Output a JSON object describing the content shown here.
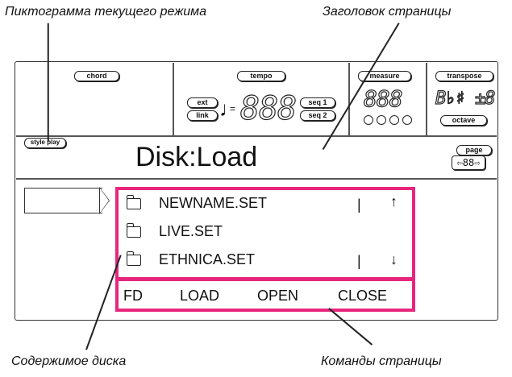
{
  "captions": {
    "top_left": "Пиктограмма текущего режима",
    "top_right": "Заголовок страницы",
    "bottom_left": "Содержимое диска",
    "bottom_right": "Команды страницы"
  },
  "labels": {
    "chord": "chord",
    "tempo": "tempo",
    "ext": "ext",
    "link": "link",
    "seq1": "seq 1",
    "seq2": "seq 2",
    "measure": "measure",
    "transpose": "transpose",
    "octave": "octave",
    "style_play": "style play",
    "page": "page"
  },
  "readouts": {
    "tempo_digits": "888",
    "measure_digits": "888",
    "transpose_digits": "B♭♯ ±8",
    "page_digits": "⇦88⇨"
  },
  "page_title": "Disk:Load",
  "files": [
    {
      "name": "NEWNAME.SET",
      "marker": "|",
      "arrow": "↑"
    },
    {
      "name": "LIVE.SET",
      "marker": "",
      "arrow": ""
    },
    {
      "name": "ETHNICA.SET",
      "marker": "|",
      "arrow": "↓"
    }
  ],
  "commands": [
    "FD",
    "LOAD",
    "OPEN",
    "CLOSE"
  ],
  "accent_color": "#e8267d"
}
